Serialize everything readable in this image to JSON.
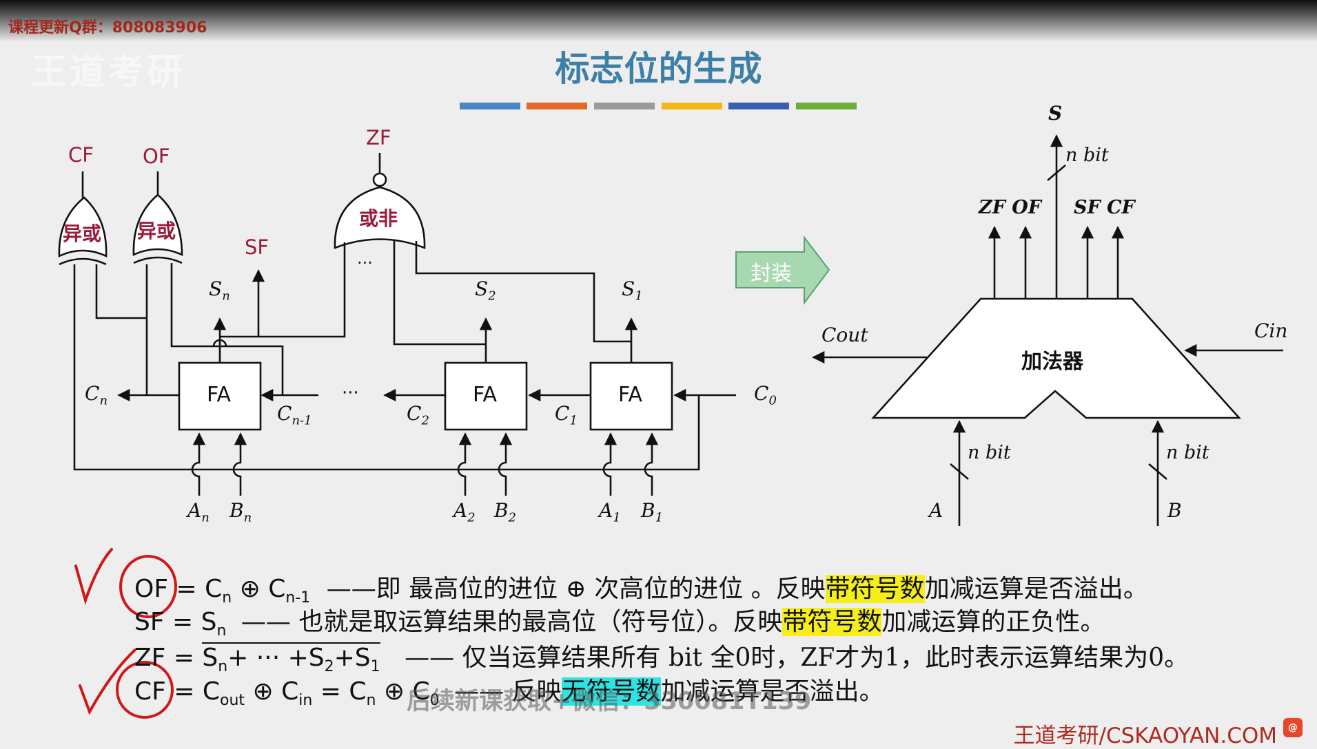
{
  "header": {
    "qq_group": "课程更新Q群：808083906",
    "watermark_logo": "王道考研"
  },
  "title": "标志位的生成",
  "colors": {
    "title": "#3d7fa6",
    "flag_labels": "#9b1a3a",
    "encapsulate_arrow": "#a8d8b0",
    "highlight_yellow": "#f5ee1a",
    "highlight_cyan": "#2fe3e3",
    "annotation_red": "#d01818",
    "color_bars": [
      "#4a86c2",
      "#e06a2a",
      "#9a9a9a",
      "#f0b81c",
      "#3a5fb0",
      "#6cae3e"
    ]
  },
  "circuit": {
    "flag_labels": {
      "cf": "CF",
      "of": "OF",
      "zf": "ZF",
      "sf": "SF"
    },
    "xor_gate_label": "异或",
    "nor_gate_label": "或非",
    "nor_dots": "···",
    "adder_label": "FA",
    "middle_dots": "···",
    "sum_labels": {
      "sn_main": "S",
      "sn_sub": "n",
      "s2_main": "S",
      "s2_sub": "2",
      "s1_main": "S",
      "s1_sub": "1"
    },
    "carry_labels": {
      "cn_main": "C",
      "cn_sub": "n",
      "cn1_main": "C",
      "cn1_sub": "n-1",
      "c2_main": "C",
      "c2_sub": "2",
      "c1_main": "C",
      "c1_sub": "1",
      "c0_main": "C",
      "c0_sub": "0"
    },
    "input_labels": {
      "an_main": "A",
      "an_sub": "n",
      "bn_main": "B",
      "bn_sub": "n",
      "a2_main": "A",
      "a2_sub": "2",
      "b2_main": "B",
      "b2_sub": "2",
      "a1_main": "A",
      "a1_sub": "1",
      "b1_main": "B",
      "b1_sub": "1"
    }
  },
  "encapsulate_label": "封装",
  "adder_block": {
    "label": "加法器",
    "s_label": "S",
    "n_bit": "n bit",
    "zf_of": "ZF OF",
    "sf_cf": "SF CF",
    "cout": "Cout",
    "cin": "Cin",
    "a": "A",
    "b": "B"
  },
  "formulas": {
    "of": {
      "lhs": "OF",
      "eq": " = C",
      "sub1": "n",
      "op": " ⊕ C",
      "sub2": "n-1",
      "desc_before": "——即 最高位的进位 ⊕ 次高位的进位 。反映",
      "highlight": "带符号数",
      "desc_after": "加减运算是否溢出。"
    },
    "sf": {
      "lhs": "SF = S",
      "sub": "n",
      "desc_before": "—— 也就是取运算结果的最高位（符号位）。反映",
      "highlight": "带符号数",
      "desc_after": "加减运算的正负性。"
    },
    "zf": {
      "lhs": "ZF = ",
      "t1": "S",
      "t1sub": "n",
      "t2": "+ ··· +S",
      "t2sub": "2",
      "t3": "+S",
      "t3sub": "1",
      "desc": "—— 仅当运算结果所有 bit 全0时，ZF才为1，此时表示运算结果为0。"
    },
    "cf": {
      "lhs": "CF",
      "eq": " = C",
      "sub1": "out",
      "op1": " ⊕ C",
      "sub2": "in",
      "eq2": " = C",
      "sub3": "n",
      "op2": " ⊕ C",
      "sub4": "0",
      "desc_before": "—— 反映",
      "highlight": "无符号数",
      "desc_after": "加减运算是否溢出。"
    }
  },
  "video_subtitle": "后续新课获取+微信：330081T139",
  "footer": {
    "site": "王道考研/CSKAOYAN.COM",
    "badge": "@"
  }
}
